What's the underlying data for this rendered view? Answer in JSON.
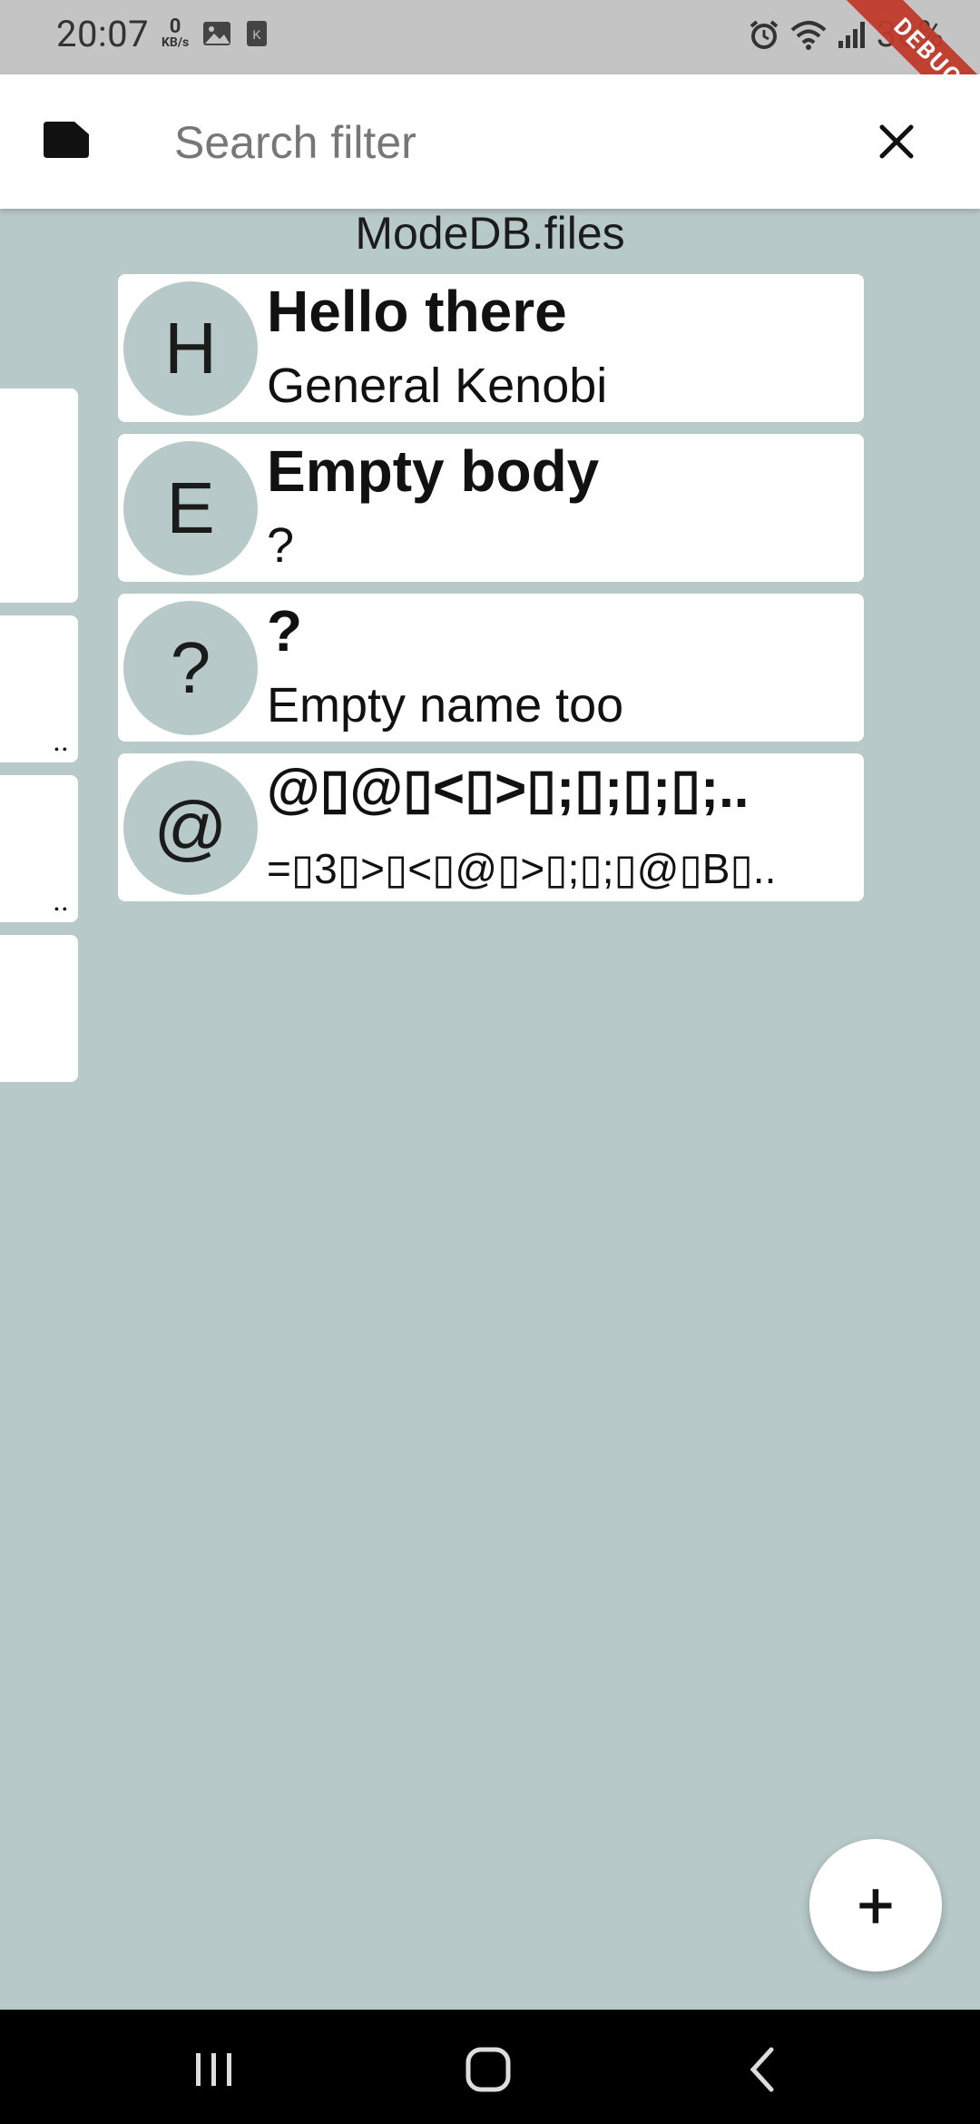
{
  "status_bar": {
    "time": "20:07",
    "net_speed_value": "0",
    "net_speed_unit": "KB/s",
    "battery": "36%",
    "debug_banner": "DEBUG"
  },
  "app_bar": {
    "search_placeholder": "Search filter",
    "search_value": ""
  },
  "list_title": "ModeDB.files",
  "notes": [
    {
      "avatar": "H",
      "title": "Hello there",
      "body": "General Kenobi"
    },
    {
      "avatar": "E",
      "title": "Empty body",
      "body": "?"
    },
    {
      "avatar": "?",
      "title": "?",
      "body": "Empty name too"
    },
    {
      "avatar": "@",
      "title": "@▯@▯<▯>▯;▯;▯;▯;..",
      "body": "=▯3▯>▯<▯@▯>▯;▯;▯@▯B▯.."
    }
  ],
  "left_cards": [
    {
      "text": ""
    },
    {
      "text": ".."
    },
    {
      "text": ".."
    },
    {
      "text": ""
    }
  ],
  "fab": {
    "label": "+"
  },
  "colors": {
    "background": "#b8c9ca",
    "card": "#ffffff",
    "status_bar": "#c4c4c4",
    "nav_bar": "#000000",
    "debug_ribbon": "#c0392b"
  },
  "icons": {
    "app_bar_left": "folder-icon",
    "app_bar_right": "close-icon",
    "nav": [
      "recent-apps-icon",
      "home-icon",
      "back-icon"
    ]
  }
}
